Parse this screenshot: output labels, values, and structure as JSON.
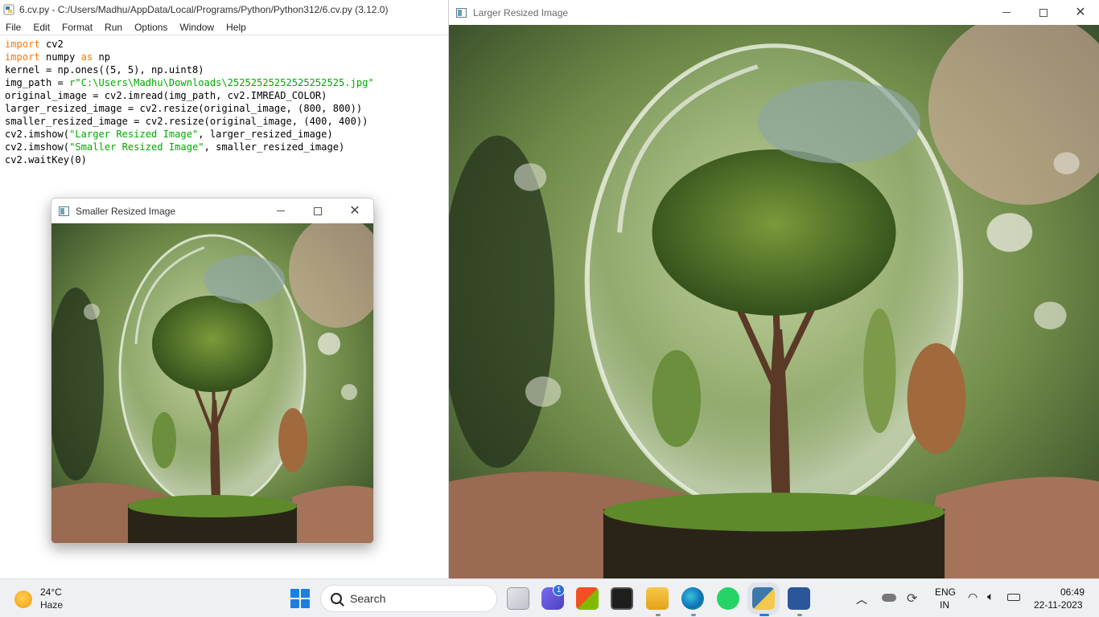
{
  "idle": {
    "title": "6.cv.py - C:/Users/Madhu/AppData/Local/Programs/Python/Python312/6.cv.py (3.12.0)",
    "menu": [
      "File",
      "Edit",
      "Format",
      "Run",
      "Options",
      "Window",
      "Help"
    ],
    "code": [
      {
        "kw": "import",
        "rest": " cv2"
      },
      {
        "kw": "import",
        "mid": " numpy ",
        "kw2": "as",
        "rest": " np"
      },
      {
        "pre": "kernel = np.ones((5, 5), np.uint8)"
      },
      {
        "pre": "img_path = ",
        "str": "r\"C:\\Users\\Madhu\\Downloads\\25252525252525252525.jpg\""
      },
      {
        "pre": "original_image = cv2.imread(img_path, cv2.IMREAD_COLOR)"
      },
      {
        "pre": "larger_resized_image = cv2.resize(original_image, (800, 800))"
      },
      {
        "pre": "smaller_resized_image = cv2.resize(original_image, (400, 400))"
      },
      {
        "pre": "cv2.imshow(",
        "str": "\"Larger Resized Image\"",
        "post": ", larger_resized_image)"
      },
      {
        "pre": "cv2.imshow(",
        "str": "\"Smaller Resized Image\"",
        "post": ", smaller_resized_image)"
      },
      {
        "pre": "cv2.waitKey(0)"
      }
    ]
  },
  "large_window": {
    "title": "Larger Resized Image"
  },
  "small_window": {
    "title": "Smaller Resized Image"
  },
  "taskbar": {
    "weather": {
      "temp": "24°C",
      "condition": "Haze"
    },
    "search_label": "Search",
    "badge_count": "1",
    "lang_top": "ENG",
    "lang_bottom": "IN",
    "time": "06:49",
    "date": "22-11-2023"
  },
  "colors": {
    "keyword": "#ff7700",
    "string": "#00aa00",
    "accent": "#1b7fe0"
  }
}
